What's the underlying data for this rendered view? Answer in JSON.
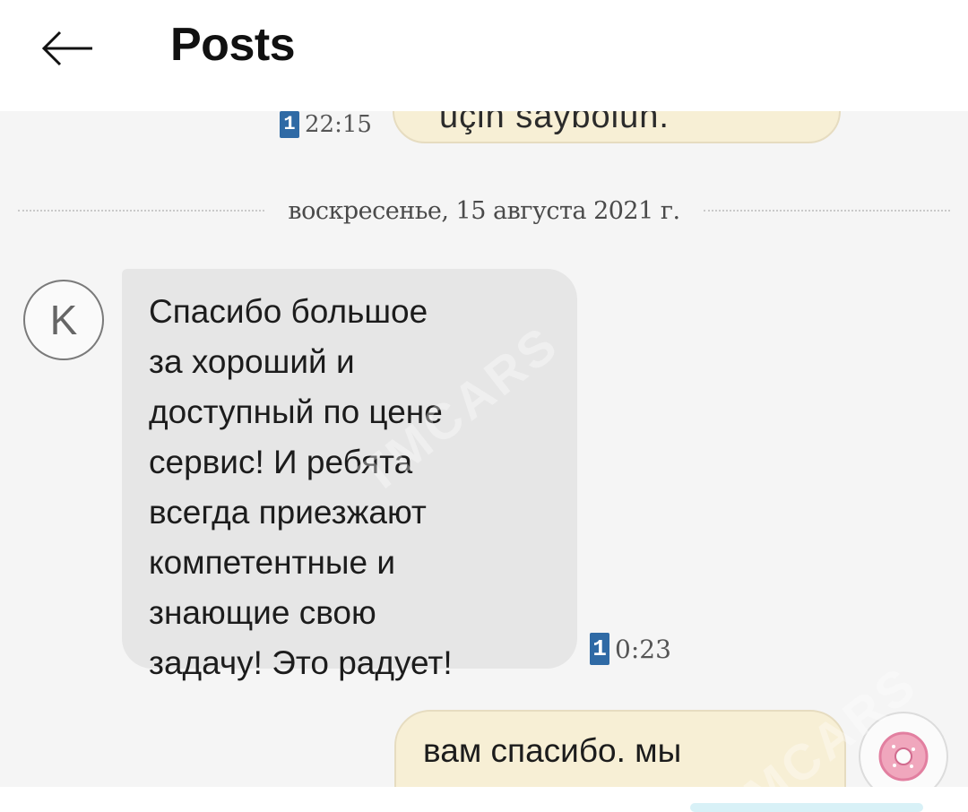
{
  "header": {
    "title": "Posts",
    "back_icon": "arrow-left-icon"
  },
  "chat": {
    "prev_message": {
      "text": "uçin saýbolun.",
      "sim_tag": "1",
      "time": "22:15"
    },
    "date_separator": "воскресенье, 15 августа 2021 г.",
    "incoming": {
      "avatar_letter": "K",
      "text": "Спасибо большое\nза хороший и\nдоступный по цене\nсервис! И ребята\nвсегда приезжают\nкомпетентные и\nзнающие свою\nзадачу! Это радует!",
      "sim_tag": "1",
      "time": "0:23"
    },
    "outgoing": {
      "text_line1": "вам спасибо. мы",
      "text_line2": "",
      "avatar_icon": "donut-icon"
    },
    "watermark": "TMCARS"
  },
  "colors": {
    "incoming_bubble": "#e6e6e6",
    "outgoing_bubble": "#f7efd5",
    "sim_tag": "#2f6aa5"
  }
}
